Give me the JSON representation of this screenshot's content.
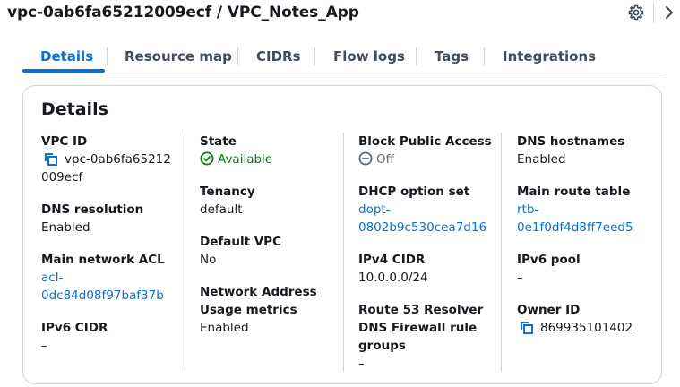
{
  "header": {
    "title": "vpc-0ab6fa65212009ecf / VPC_Notes_App",
    "settings_icon": "gear-icon",
    "expand_icon": "chevron-right-icon"
  },
  "tabs": [
    {
      "label": "Details",
      "active": true
    },
    {
      "label": "Resource map",
      "active": false
    },
    {
      "label": "CIDRs",
      "active": false
    },
    {
      "label": "Flow logs",
      "active": false
    },
    {
      "label": "Tags",
      "active": false
    },
    {
      "label": "Integrations",
      "active": false
    }
  ],
  "details": {
    "title": "Details",
    "vpc_id": {
      "label": "VPC ID",
      "value_line1": "vpc-0ab6fa65212",
      "value_line2": "009ecf"
    },
    "dns_resolution": {
      "label": "DNS resolution",
      "value": "Enabled"
    },
    "main_network_acl": {
      "label": "Main network ACL",
      "value_line1": "acl-",
      "value_line2": "0dc84d08f97baf37b"
    },
    "ipv6_cidr": {
      "label": "IPv6 CIDR",
      "value": "–"
    },
    "state": {
      "label": "State",
      "value": "Available"
    },
    "tenancy": {
      "label": "Tenancy",
      "value": "default"
    },
    "default_vpc": {
      "label": "Default VPC",
      "value": "No"
    },
    "network_address_usage": {
      "label_line1": "Network Address",
      "label_line2": "Usage metrics",
      "value": "Enabled"
    },
    "block_public_access": {
      "label": "Block Public Access",
      "value": "Off"
    },
    "dhcp_option_set": {
      "label": "DHCP option set",
      "value_line1": "dopt-",
      "value_line2": "0802b9c530cea7d16"
    },
    "ipv4_cidr": {
      "label": "IPv4 CIDR",
      "value": "10.0.0.0/24"
    },
    "route53_resolver": {
      "label_line1": "Route 53 Resolver",
      "label_line2": "DNS Firewall rule",
      "label_line3": "groups",
      "value": "–"
    },
    "dns_hostnames": {
      "label": "DNS hostnames",
      "value": "Enabled"
    },
    "main_route_table": {
      "label": "Main route table",
      "value_line1": "rtb-",
      "value_line2": "0e1f0df4d8ff7eed5"
    },
    "ipv6_pool": {
      "label": "IPv6 pool",
      "value": "–"
    },
    "owner_id": {
      "label": "Owner ID",
      "value": "869935101402"
    }
  },
  "colors": {
    "link": "#0972d3",
    "success": "#037f0c",
    "muted": "#5f6b7a",
    "text": "#16191f",
    "border": "#d1d5db"
  }
}
